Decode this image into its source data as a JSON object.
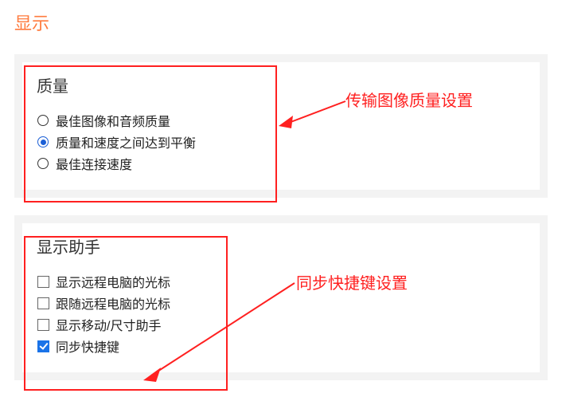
{
  "page_title": "显示",
  "section_quality": {
    "title": "质量",
    "options": [
      {
        "label": "最佳图像和音频质量",
        "selected": false
      },
      {
        "label": "质量和速度之间达到平衡",
        "selected": true
      },
      {
        "label": "最佳连接速度",
        "selected": false
      }
    ],
    "annotation": "传输图像质量设置"
  },
  "section_display_helpers": {
    "title": "显示助手",
    "options": [
      {
        "label": "显示远程电脑的光标",
        "checked": false
      },
      {
        "label": "跟随远程电脑的光标",
        "checked": false
      },
      {
        "label": "显示移动/尺寸助手",
        "checked": false
      },
      {
        "label": "同步快捷键",
        "checked": true
      }
    ],
    "annotation": "同步快捷键设置"
  }
}
